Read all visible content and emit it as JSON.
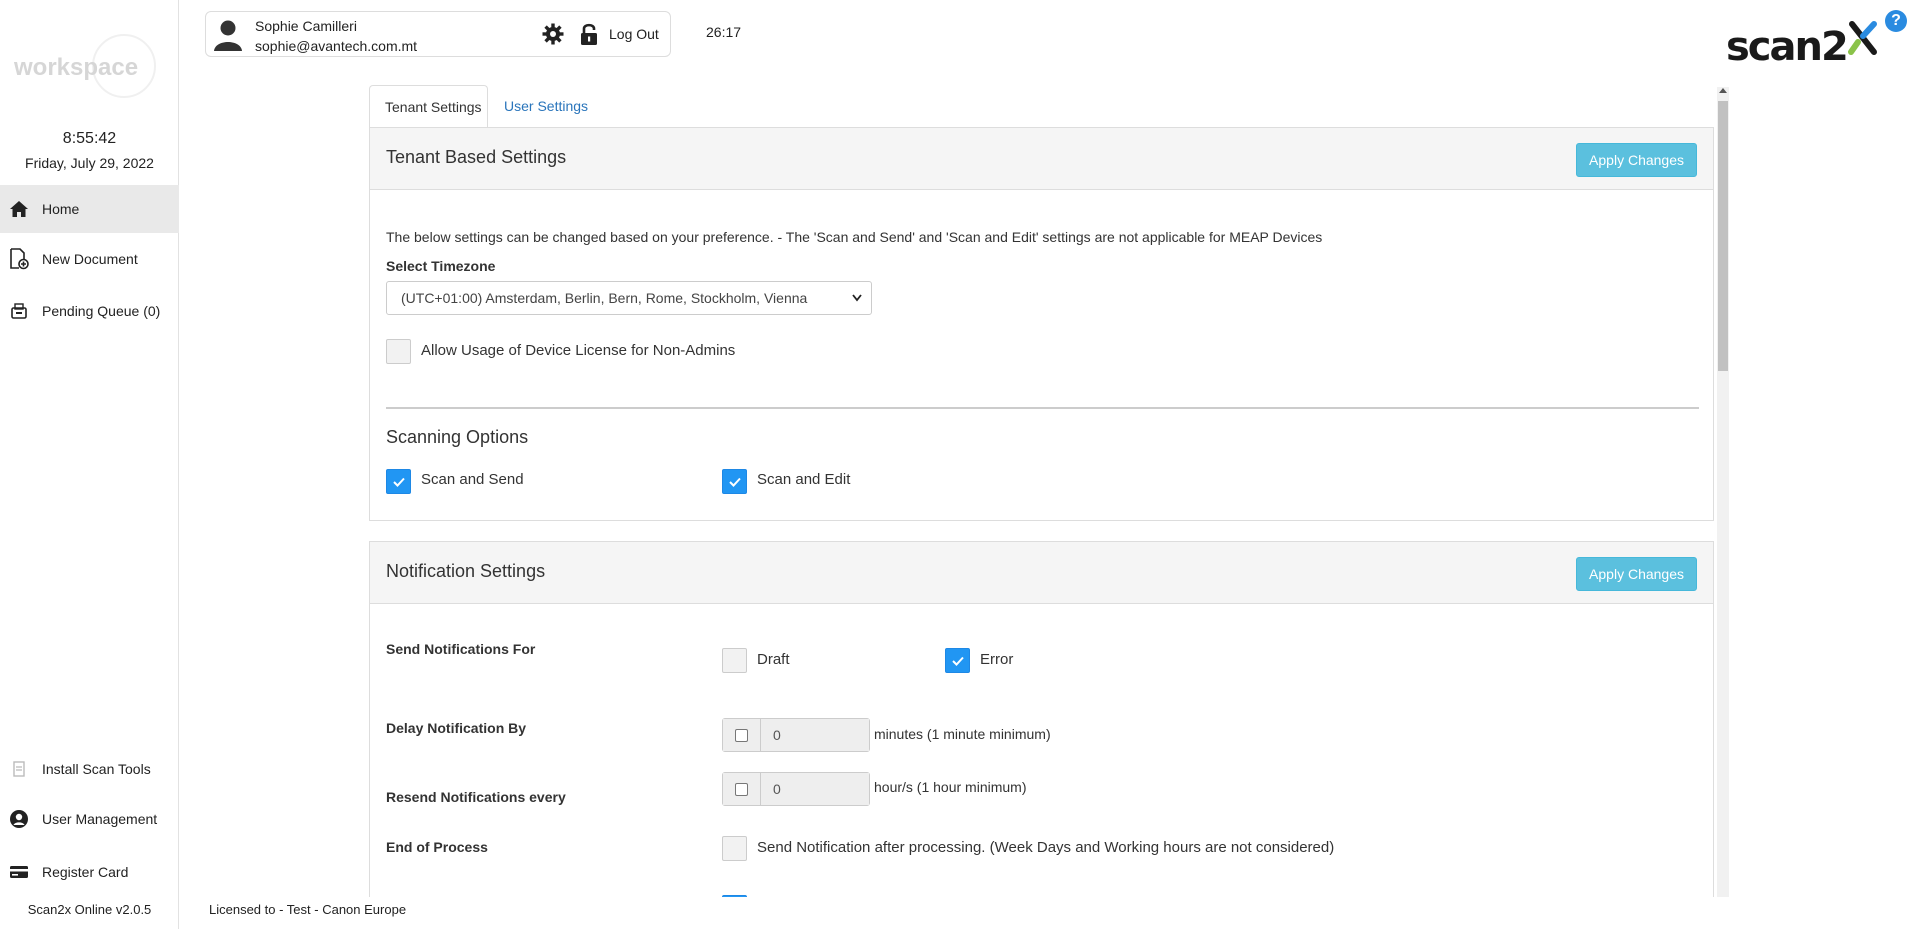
{
  "sidebar": {
    "logo_text": "workspace",
    "clock_time": "8:55:42",
    "clock_date": "Friday, July 29, 2022",
    "items": [
      {
        "label": "Home",
        "icon": "home-icon"
      },
      {
        "label": "New Document",
        "icon": "new-document-icon"
      },
      {
        "label": "Pending Queue (0)",
        "icon": "printer-icon"
      }
    ],
    "bottom_items": [
      {
        "label": "Install Scan Tools",
        "icon": "install-icon"
      },
      {
        "label": "User Management",
        "icon": "user-circle-icon"
      },
      {
        "label": "Register Card",
        "icon": "card-icon"
      }
    ],
    "version": "Scan2x Online v2.0.5"
  },
  "user": {
    "name": "Sophie Camilleri",
    "email": "sophie@avantech.com.mt",
    "logout_label": "Log Out"
  },
  "session_timer": "26:17",
  "brand": {
    "name": "scan2x",
    "accent": "#2a8be0"
  },
  "help_label": "?",
  "tabs": [
    {
      "label": "Tenant Settings",
      "active": true
    },
    {
      "label": "User Settings",
      "active": false
    }
  ],
  "tenant_panel": {
    "title": "Tenant Based Settings",
    "apply_label": "Apply Changes",
    "description": "The below settings can be changed based on your preference. - The 'Scan and Send' and 'Scan and Edit' settings are not applicable for MEAP Devices",
    "timezone_label": "Select Timezone",
    "timezone_value": "(UTC+01:00) Amsterdam, Berlin, Bern, Rome, Stockholm, Vienna",
    "allow_license_label": "Allow Usage of Device License for Non-Admins",
    "allow_license_checked": false,
    "scanning_title": "Scanning Options",
    "scan_send_label": "Scan and Send",
    "scan_send_checked": true,
    "scan_edit_label": "Scan and Edit",
    "scan_edit_checked": true
  },
  "notification_panel": {
    "title": "Notification Settings",
    "apply_label": "Apply Changes",
    "send_for_label": "Send Notifications For",
    "draft_label": "Draft",
    "draft_checked": false,
    "error_label": "Error",
    "error_checked": true,
    "delay_label": "Delay Notification By",
    "delay_value": "0",
    "delay_hint": "minutes (1 minute minimum)",
    "resend_label": "Resend Notifications every",
    "resend_value": "0",
    "resend_hint": "hour/s (1 hour minimum)",
    "end_label": "End of Process",
    "end_option_label": "Send Notification after processing. (Week Days and Working hours are not considered)",
    "end_checked": false
  },
  "footer_license": "Licensed to - Test - Canon Europe",
  "colors": {
    "checkbox_checked": "#2196f3",
    "apply_button": "#5bc0de",
    "tab_link": "#2a75bb"
  }
}
